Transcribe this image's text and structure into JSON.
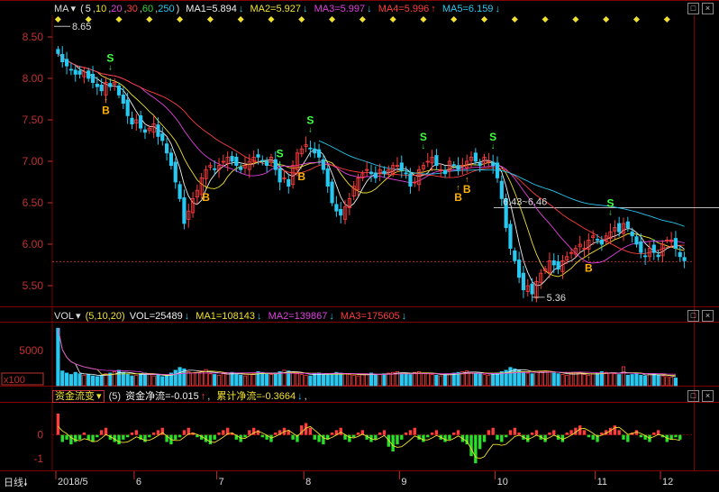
{
  "colors": {
    "up": "#ff3c3c",
    "down": "#28c8f0",
    "ma5": "#f0f0f0",
    "ma10": "#f0e030",
    "ma20": "#e040e0",
    "ma60": "#40d040",
    "ma250": "#4080ff",
    "grid": "#800000",
    "axis": "#c03030",
    "buy": "#ffb000",
    "sell": "#40ff40"
  },
  "price_panel": {
    "indicator_button": "MA",
    "params_open": "(",
    "params": [
      "5",
      "10",
      "20",
      "30",
      "60",
      "250"
    ],
    "params_close": ")",
    "ma_labels": [
      {
        "text": "MA1=5.894",
        "color": "#f0f0f0"
      },
      {
        "text": "MA2=5.927",
        "color": "#f0e030"
      },
      {
        "text": "MA3=5.997",
        "color": "#e040e0"
      },
      {
        "text": "MA4=5.996",
        "color": "#ff3c3c"
      },
      {
        "text": "MA5=6.159",
        "color": "#28c8f0"
      }
    ],
    "arrows": [
      "↓",
      "↓",
      "↓",
      "↑",
      "↓"
    ],
    "y_ticks": [
      "8.50",
      "8.00",
      "7.50",
      "7.00",
      "6.50",
      "6.00",
      "5.50"
    ],
    "annotations": {
      "high": "8.65",
      "low": "5.36",
      "range": "6.43~6.46"
    },
    "buy_label": "B",
    "sell_label": "S"
  },
  "volume_panel": {
    "indicator_button": "VOL",
    "params": "(5,10,20)",
    "labels": [
      {
        "text": "VOL=25489",
        "color": "#f0f0f0"
      },
      {
        "text": "MA1=108143",
        "color": "#f0e030"
      },
      {
        "text": "MA2=139867",
        "color": "#e040e0"
      },
      {
        "text": "MA3=175605",
        "color": "#ff3c3c"
      }
    ],
    "arrows": [
      "↓",
      "↓",
      "↓",
      "↓"
    ],
    "y_ticks": [
      "5000"
    ],
    "unit": "x100"
  },
  "flow_panel": {
    "indicator_button": "资金流变",
    "param": "(5)",
    "labels": [
      {
        "text": "资金净流=-0.015",
        "color": "#f0f0f0"
      },
      {
        "text": "累计净流=-0.3664",
        "color": "#f0e030"
      }
    ],
    "arrows": [
      "↑",
      "↓"
    ],
    "separators": [
      ",",
      ","
    ],
    "y_ticks": [
      "0",
      "-1"
    ]
  },
  "time_axis": {
    "period_button": "日线",
    "labels": [
      "2018/5",
      "6",
      "7",
      "8",
      "9",
      "10",
      "11",
      "12"
    ]
  },
  "window_controls": [
    "□",
    "×"
  ],
  "chart_data": {
    "type": "candlestick",
    "y_range": [
      5.25,
      8.75
    ],
    "high": 8.65,
    "low": 5.36,
    "dates": [],
    "series": [
      {
        "name": "MA1",
        "last": 5.894
      },
      {
        "name": "MA2",
        "last": 5.927
      },
      {
        "name": "MA3",
        "last": 5.997
      },
      {
        "name": "MA4",
        "last": 5.996
      },
      {
        "name": "MA5",
        "last": 6.159
      }
    ],
    "closes": [
      8.3,
      8.2,
      8.15,
      8.1,
      8.05,
      8.05,
      8.08,
      8.0,
      7.95,
      7.9,
      7.85,
      7.95,
      7.9,
      7.95,
      7.8,
      7.7,
      7.55,
      7.45,
      7.5,
      7.4,
      7.35,
      7.4,
      7.45,
      7.3,
      7.25,
      7.1,
      6.95,
      6.75,
      6.55,
      6.25,
      6.4,
      6.55,
      6.65,
      6.8,
      6.9,
      6.95,
      6.9,
      6.95,
      7.0,
      7.05,
      7.0,
      6.95,
      6.9,
      6.95,
      7.0,
      7.05,
      7.05,
      7.0,
      6.95,
      7.05,
      6.9,
      6.75,
      6.8,
      6.7,
      6.95,
      7.1,
      7.15,
      7.2,
      7.15,
      7.1,
      7.05,
      6.9,
      6.7,
      6.5,
      6.4,
      6.35,
      6.45,
      6.55,
      6.7,
      6.8,
      6.85,
      6.9,
      6.85,
      6.8,
      6.9,
      6.85,
      6.9,
      6.95,
      6.95,
      6.9,
      6.85,
      6.7,
      6.75,
      6.9,
      6.95,
      7.0,
      7.05,
      6.95,
      6.9,
      6.85,
      7.0,
      6.95,
      6.9,
      6.95,
      7.0,
      7.05,
      7.0,
      6.95,
      7.05,
      7.0,
      6.95,
      6.8,
      6.55,
      6.2,
      5.95,
      5.8,
      5.6,
      5.45,
      5.5,
      5.4,
      5.55,
      5.65,
      5.7,
      5.8,
      5.75,
      5.7,
      5.8,
      5.85,
      5.9,
      5.95,
      6.0,
      5.95,
      6.05,
      6.1,
      6.05,
      6.0,
      6.1,
      6.15,
      6.2,
      6.15,
      6.25,
      6.2,
      6.1,
      6.0,
      5.9,
      5.85,
      5.95,
      5.9,
      5.85,
      6.0,
      6.05,
      6.05,
      5.95,
      5.85,
      5.8
    ],
    "volumes": [
      820,
      210,
      180,
      160,
      190,
      170,
      150,
      160,
      140,
      130,
      150,
      170,
      180,
      200,
      220,
      190,
      160,
      140,
      150,
      170,
      180,
      160,
      140,
      150,
      130,
      140,
      180,
      220,
      260,
      240,
      200,
      180,
      190,
      210,
      230,
      170,
      160,
      150,
      170,
      180,
      190,
      160,
      150,
      140,
      170,
      180,
      200,
      190,
      170,
      160,
      180,
      200,
      220,
      210,
      190,
      170,
      160,
      150,
      140,
      170,
      180,
      160,
      150,
      170,
      190,
      180,
      170,
      160,
      150,
      140,
      160,
      170,
      180,
      150,
      160,
      170,
      180,
      190,
      200,
      180,
      170,
      160,
      190,
      200,
      180,
      170,
      160,
      150,
      140,
      160,
      170,
      180,
      190,
      200,
      210,
      190,
      180,
      170,
      160,
      150,
      170,
      180,
      200,
      220,
      260,
      240,
      220,
      200,
      180,
      170,
      190,
      200,
      210,
      200,
      180,
      170,
      160,
      150,
      170,
      180,
      190,
      160,
      150,
      170,
      180,
      200,
      190,
      180,
      170,
      160,
      270,
      150,
      160,
      170,
      150,
      140,
      160,
      170,
      150,
      140,
      130,
      120,
      110
    ],
    "flows": [
      0.9,
      -0.3,
      -0.2,
      -0.4,
      -0.3,
      -0.2,
      0.1,
      -0.2,
      -0.3,
      -0.1,
      0.2,
      0.3,
      -0.2,
      -0.3,
      -0.4,
      -0.2,
      -0.1,
      0.1,
      0.2,
      -0.2,
      -0.3,
      -0.1,
      0.1,
      0.2,
      0.3,
      -0.3,
      -0.4,
      -0.2,
      -0.1,
      0.2,
      0.3,
      0.1,
      -0.1,
      -0.2,
      -0.3,
      -0.4,
      -0.2,
      0.1,
      0.2,
      0.3,
      0.1,
      -0.2,
      -0.3,
      -0.1,
      0.2,
      0.3,
      0.2,
      -0.1,
      -0.2,
      -0.3,
      0.1,
      0.2,
      0.3,
      0.2,
      -0.2,
      -0.3,
      0.4,
      0.5,
      0.3,
      -0.2,
      -0.3,
      -0.4,
      -0.2,
      0.1,
      0.2,
      0.3,
      -0.2,
      -0.3,
      -0.1,
      0.1,
      0.2,
      -0.2,
      -0.3,
      -0.2,
      0.1,
      0.2,
      -0.5,
      -0.7,
      -0.4,
      -0.2,
      0.1,
      0.2,
      0.3,
      -0.2,
      -0.3,
      -0.1,
      0.1,
      0.2,
      -0.2,
      -0.3,
      -0.2,
      0.1,
      0.2,
      -0.3,
      -0.4,
      -0.9,
      -1.2,
      -0.6,
      -0.3,
      0.2,
      0.3,
      -0.2,
      -0.3,
      -0.1,
      0.2,
      0.3,
      0.1,
      -0.2,
      -0.3,
      0.1,
      0.2,
      -0.2,
      -0.3,
      0.1,
      0.2,
      -0.2,
      -0.3,
      0.1,
      0.2,
      0.3,
      0.4,
      0.2,
      -0.1,
      -0.2,
      -0.3,
      0.1,
      0.2,
      0.3,
      0.4,
      0.2,
      -0.2,
      -0.3,
      0.1,
      0.2,
      -0.1,
      -0.2,
      -0.3,
      0.1,
      0.2,
      -0.1,
      -0.3,
      -0.2,
      -0.1,
      -0.2
    ],
    "buy_points": [
      11,
      34,
      56,
      92,
      94,
      122
    ],
    "sell_points": [
      12,
      51,
      58,
      84,
      100,
      127
    ]
  }
}
